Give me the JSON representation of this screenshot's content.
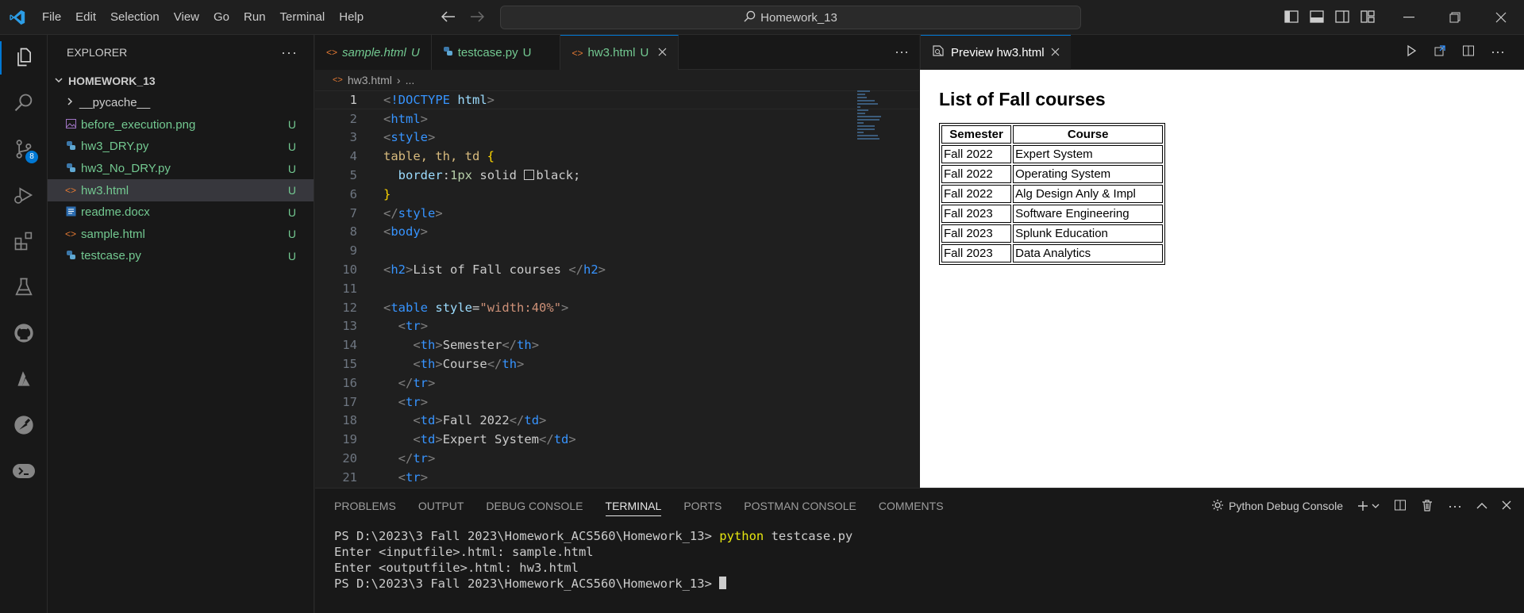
{
  "titlebar": {
    "menu": [
      "File",
      "Edit",
      "Selection",
      "View",
      "Go",
      "Run",
      "Terminal",
      "Help"
    ],
    "search_text": "Homework_13"
  },
  "activity": {
    "scm_badge": "8"
  },
  "explorer": {
    "title": "EXPLORER",
    "folder": "HOMEWORK_13",
    "items": [
      {
        "name": "__pycache__",
        "type": "folder"
      },
      {
        "name": "before_execution.png",
        "type": "image",
        "status": "U"
      },
      {
        "name": "hw3_DRY.py",
        "type": "python",
        "status": "U"
      },
      {
        "name": "hw3_No_DRY.py",
        "type": "python",
        "status": "U"
      },
      {
        "name": "hw3.html",
        "type": "html",
        "status": "U",
        "selected": true
      },
      {
        "name": "readme.docx",
        "type": "word",
        "status": "U"
      },
      {
        "name": "sample.html",
        "type": "html",
        "status": "U"
      },
      {
        "name": "testcase.py",
        "type": "python",
        "status": "U"
      }
    ]
  },
  "tabs": [
    {
      "label": "sample.html",
      "status": "U",
      "italic": true
    },
    {
      "label": "testcase.py",
      "status": "U"
    },
    {
      "label": "hw3.html",
      "status": "U",
      "active": true
    }
  ],
  "breadcrumb": {
    "file": "hw3.html",
    "rest": "..."
  },
  "code_lines": [
    "1",
    "2",
    "3",
    "4",
    "5",
    "6",
    "7",
    "8",
    "9",
    "10",
    "11",
    "12",
    "13",
    "14",
    "15",
    "16",
    "17",
    "18",
    "19",
    "20",
    "21"
  ],
  "code": {
    "doctype_kw": "!DOCTYPE",
    "doctype_val": "html",
    "html": "html",
    "style": "style",
    "sel": "table, th, td",
    "prop": "border",
    "val1": "1px",
    "val2": "solid",
    "val3": "black;",
    "body": "body",
    "h2": "h2",
    "h2_text": "List of Fall courses ",
    "table": "table",
    "table_attr": "style",
    "table_val": "\"width:40%\"",
    "tr": "tr",
    "th": "th",
    "td": "td",
    "th1": "Semester",
    "th2": "Course",
    "td1": "Fall 2022",
    "td2": "Expert System"
  },
  "preview": {
    "tab_label": "Preview hw3.html",
    "heading": "List of Fall courses",
    "headers": [
      "Semester",
      "Course"
    ],
    "rows": [
      [
        "Fall 2022",
        "Expert System"
      ],
      [
        "Fall 2022",
        "Operating System"
      ],
      [
        "Fall 2022",
        "Alg Design Anly & Impl"
      ],
      [
        "Fall 2023",
        "Software Engineering"
      ],
      [
        "Fall 2023",
        "Splunk Education"
      ],
      [
        "Fall 2023",
        "Data Analytics"
      ]
    ]
  },
  "panel": {
    "tabs": [
      "PROBLEMS",
      "OUTPUT",
      "DEBUG CONSOLE",
      "TERMINAL",
      "PORTS",
      "POSTMAN CONSOLE",
      "COMMENTS"
    ],
    "active_tab": "TERMINAL",
    "console_label": "Python Debug Console",
    "terminal": {
      "prompt1": "PS D:\\2023\\3 Fall 2023\\Homework_ACS560\\Homework_13> ",
      "cmd1": "python",
      "args1": " testcase.py",
      "line2": "Enter <inputfile>.html: sample.html",
      "line3": "Enter <outputfile>.html: hw3.html",
      "prompt2": "PS D:\\2023\\3 Fall 2023\\Homework_ACS560\\Homework_13> "
    }
  }
}
